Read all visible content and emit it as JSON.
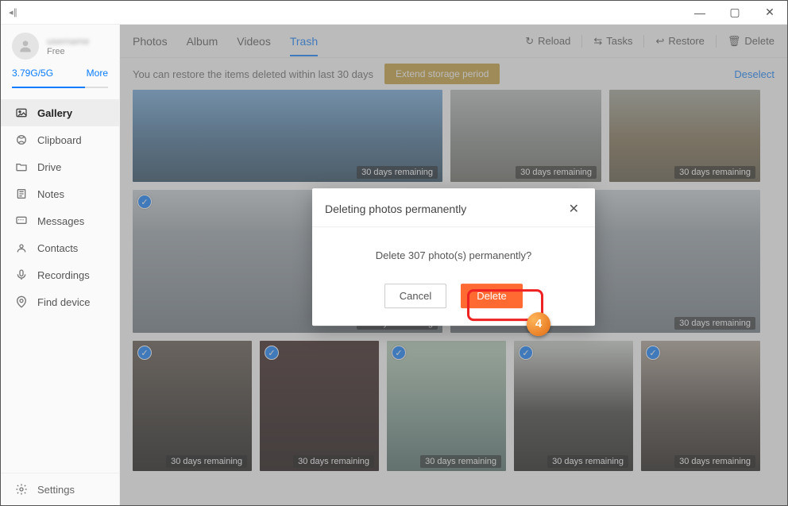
{
  "window": {
    "title": ""
  },
  "profile": {
    "name": "username",
    "plan": "Free"
  },
  "storage": {
    "used": "3.79G/5G",
    "more": "More"
  },
  "nav": {
    "items": [
      {
        "label": "Gallery"
      },
      {
        "label": "Clipboard"
      },
      {
        "label": "Drive"
      },
      {
        "label": "Notes"
      },
      {
        "label": "Messages"
      },
      {
        "label": "Contacts"
      },
      {
        "label": "Recordings"
      },
      {
        "label": "Find device"
      }
    ],
    "settings": "Settings"
  },
  "tabs": {
    "items": [
      {
        "label": "Photos"
      },
      {
        "label": "Album"
      },
      {
        "label": "Videos"
      },
      {
        "label": "Trash"
      }
    ],
    "active_index": 3
  },
  "actions": {
    "reload": "Reload",
    "tasks": "Tasks",
    "restore": "Restore",
    "delete": "Delete"
  },
  "info": {
    "notice": "You can restore the items deleted within last 30 days",
    "extend": "Extend storage period",
    "deselect": "Deselect"
  },
  "thumbs": {
    "remaining_label": "30 days remaining"
  },
  "modal": {
    "title": "Deleting photos permanently",
    "body": "Delete 307 photo(s) permanently?",
    "cancel": "Cancel",
    "delete": "Delete"
  },
  "step_badge": "4"
}
